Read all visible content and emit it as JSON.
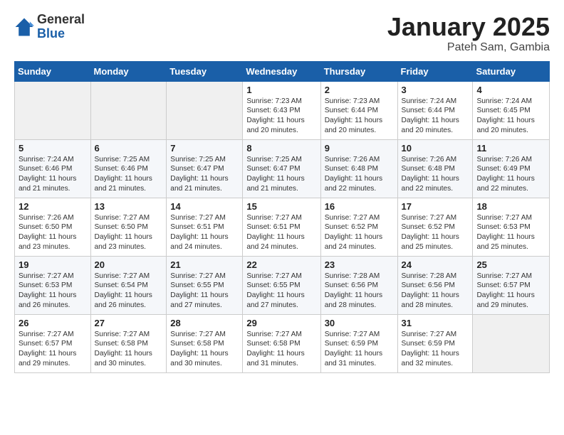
{
  "logo": {
    "general": "General",
    "blue": "Blue"
  },
  "title": {
    "month": "January 2025",
    "location": "Pateh Sam, Gambia"
  },
  "weekdays": [
    "Sunday",
    "Monday",
    "Tuesday",
    "Wednesday",
    "Thursday",
    "Friday",
    "Saturday"
  ],
  "weeks": [
    [
      {
        "day": "",
        "info": ""
      },
      {
        "day": "",
        "info": ""
      },
      {
        "day": "",
        "info": ""
      },
      {
        "day": "1",
        "info": "Sunrise: 7:23 AM\nSunset: 6:43 PM\nDaylight: 11 hours and 20 minutes."
      },
      {
        "day": "2",
        "info": "Sunrise: 7:23 AM\nSunset: 6:44 PM\nDaylight: 11 hours and 20 minutes."
      },
      {
        "day": "3",
        "info": "Sunrise: 7:24 AM\nSunset: 6:44 PM\nDaylight: 11 hours and 20 minutes."
      },
      {
        "day": "4",
        "info": "Sunrise: 7:24 AM\nSunset: 6:45 PM\nDaylight: 11 hours and 20 minutes."
      }
    ],
    [
      {
        "day": "5",
        "info": "Sunrise: 7:24 AM\nSunset: 6:46 PM\nDaylight: 11 hours and 21 minutes."
      },
      {
        "day": "6",
        "info": "Sunrise: 7:25 AM\nSunset: 6:46 PM\nDaylight: 11 hours and 21 minutes."
      },
      {
        "day": "7",
        "info": "Sunrise: 7:25 AM\nSunset: 6:47 PM\nDaylight: 11 hours and 21 minutes."
      },
      {
        "day": "8",
        "info": "Sunrise: 7:25 AM\nSunset: 6:47 PM\nDaylight: 11 hours and 21 minutes."
      },
      {
        "day": "9",
        "info": "Sunrise: 7:26 AM\nSunset: 6:48 PM\nDaylight: 11 hours and 22 minutes."
      },
      {
        "day": "10",
        "info": "Sunrise: 7:26 AM\nSunset: 6:48 PM\nDaylight: 11 hours and 22 minutes."
      },
      {
        "day": "11",
        "info": "Sunrise: 7:26 AM\nSunset: 6:49 PM\nDaylight: 11 hours and 22 minutes."
      }
    ],
    [
      {
        "day": "12",
        "info": "Sunrise: 7:26 AM\nSunset: 6:50 PM\nDaylight: 11 hours and 23 minutes."
      },
      {
        "day": "13",
        "info": "Sunrise: 7:27 AM\nSunset: 6:50 PM\nDaylight: 11 hours and 23 minutes."
      },
      {
        "day": "14",
        "info": "Sunrise: 7:27 AM\nSunset: 6:51 PM\nDaylight: 11 hours and 24 minutes."
      },
      {
        "day": "15",
        "info": "Sunrise: 7:27 AM\nSunset: 6:51 PM\nDaylight: 11 hours and 24 minutes."
      },
      {
        "day": "16",
        "info": "Sunrise: 7:27 AM\nSunset: 6:52 PM\nDaylight: 11 hours and 24 minutes."
      },
      {
        "day": "17",
        "info": "Sunrise: 7:27 AM\nSunset: 6:52 PM\nDaylight: 11 hours and 25 minutes."
      },
      {
        "day": "18",
        "info": "Sunrise: 7:27 AM\nSunset: 6:53 PM\nDaylight: 11 hours and 25 minutes."
      }
    ],
    [
      {
        "day": "19",
        "info": "Sunrise: 7:27 AM\nSunset: 6:53 PM\nDaylight: 11 hours and 26 minutes."
      },
      {
        "day": "20",
        "info": "Sunrise: 7:27 AM\nSunset: 6:54 PM\nDaylight: 11 hours and 26 minutes."
      },
      {
        "day": "21",
        "info": "Sunrise: 7:27 AM\nSunset: 6:55 PM\nDaylight: 11 hours and 27 minutes."
      },
      {
        "day": "22",
        "info": "Sunrise: 7:27 AM\nSunset: 6:55 PM\nDaylight: 11 hours and 27 minutes."
      },
      {
        "day": "23",
        "info": "Sunrise: 7:28 AM\nSunset: 6:56 PM\nDaylight: 11 hours and 28 minutes."
      },
      {
        "day": "24",
        "info": "Sunrise: 7:28 AM\nSunset: 6:56 PM\nDaylight: 11 hours and 28 minutes."
      },
      {
        "day": "25",
        "info": "Sunrise: 7:27 AM\nSunset: 6:57 PM\nDaylight: 11 hours and 29 minutes."
      }
    ],
    [
      {
        "day": "26",
        "info": "Sunrise: 7:27 AM\nSunset: 6:57 PM\nDaylight: 11 hours and 29 minutes."
      },
      {
        "day": "27",
        "info": "Sunrise: 7:27 AM\nSunset: 6:58 PM\nDaylight: 11 hours and 30 minutes."
      },
      {
        "day": "28",
        "info": "Sunrise: 7:27 AM\nSunset: 6:58 PM\nDaylight: 11 hours and 30 minutes."
      },
      {
        "day": "29",
        "info": "Sunrise: 7:27 AM\nSunset: 6:58 PM\nDaylight: 11 hours and 31 minutes."
      },
      {
        "day": "30",
        "info": "Sunrise: 7:27 AM\nSunset: 6:59 PM\nDaylight: 11 hours and 31 minutes."
      },
      {
        "day": "31",
        "info": "Sunrise: 7:27 AM\nSunset: 6:59 PM\nDaylight: 11 hours and 32 minutes."
      },
      {
        "day": "",
        "info": ""
      }
    ]
  ]
}
